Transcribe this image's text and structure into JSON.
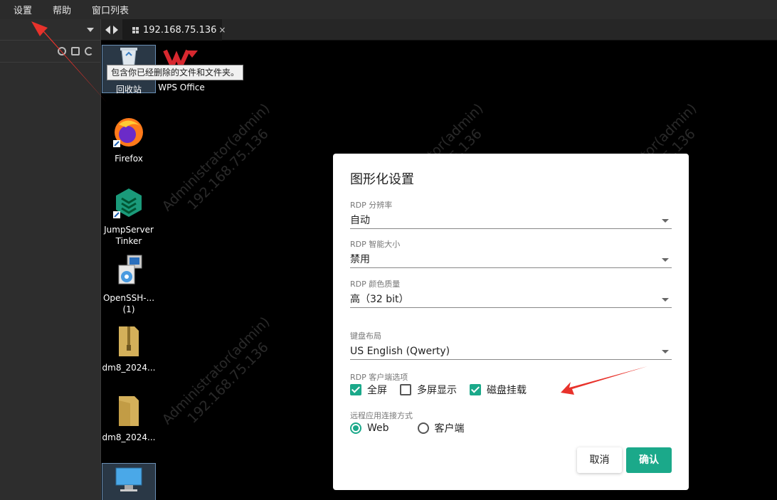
{
  "menu": [
    "设置",
    "帮助",
    "窗口列表"
  ],
  "tab": {
    "title": "192.168.75.136",
    "close": "×"
  },
  "desktop": {
    "watermark_lines": [
      "Administrator(admin)",
      "192.168.75.136"
    ],
    "tooltip": "包含你已经删除的文件和文件夹。",
    "icons": [
      {
        "label": "回收站",
        "icon": "recycle-bin-icon"
      },
      {
        "label": "WPS Office",
        "icon": "wps-icon"
      },
      {
        "label": "Firefox",
        "icon": "firefox-icon"
      },
      {
        "label": "JumpServer Tinker",
        "icon": "jumpserver-icon"
      },
      {
        "label": "OpenSSH-... (1)",
        "icon": "installer-icon"
      },
      {
        "label": "dm8_2024...",
        "icon": "zip-folder-icon"
      },
      {
        "label": "dm8_2024...",
        "icon": "folder-icon"
      },
      {
        "label": "",
        "icon": "computer-icon"
      }
    ]
  },
  "dialog": {
    "title": "图形化设置",
    "fields": [
      {
        "label": "RDP 分辨率",
        "value": "自动"
      },
      {
        "label": "RDP 智能大小",
        "value": "禁用"
      },
      {
        "label": "RDP 颜色质量",
        "value": "高（32 bit）"
      },
      {
        "label": "键盘布局",
        "value": "US English (Qwerty)"
      }
    ],
    "client_options": {
      "label": "RDP 客户端选项",
      "items": [
        {
          "label": "全屏",
          "checked": true
        },
        {
          "label": "多屏显示",
          "checked": false
        },
        {
          "label": "磁盘挂载",
          "checked": true
        }
      ]
    },
    "remote_app": {
      "label": "远程应用连接方式",
      "items": [
        {
          "label": "Web",
          "selected": true
        },
        {
          "label": "客户端",
          "selected": false
        }
      ]
    },
    "cancel": "取消",
    "confirm": "确认"
  },
  "colors": {
    "accent": "#1ba98a",
    "annotation": "#e8322b"
  }
}
